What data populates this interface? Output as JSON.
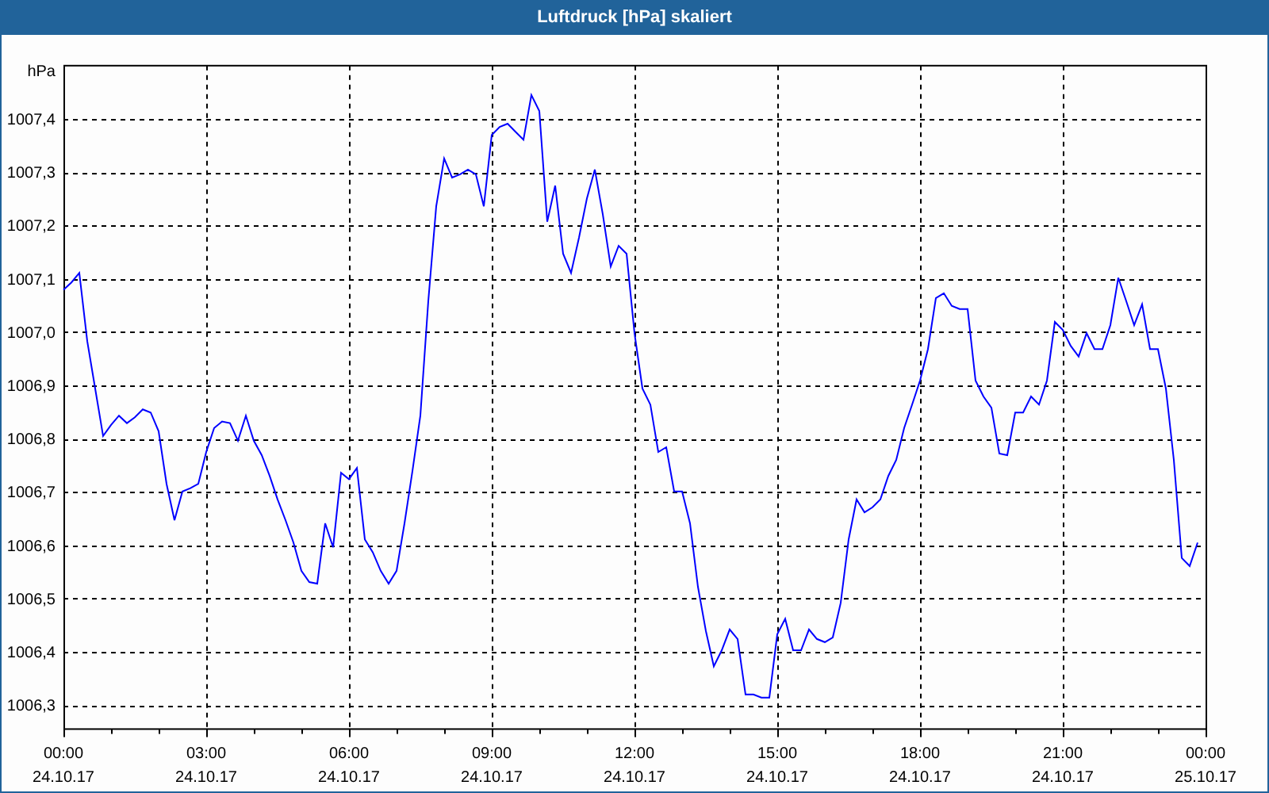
{
  "window": {
    "title": "Luftdruck [hPa] skaliert"
  },
  "chart": {
    "chart_data": {
      "type": "line",
      "ylabel": "hPa",
      "categories": [
        "00:00\n24.10.17",
        null,
        null,
        null,
        null,
        null,
        null,
        null,
        null,
        null,
        null,
        null,
        null,
        null,
        null,
        null,
        null,
        null,
        "03:00\n24.10.17",
        null,
        null,
        null,
        null,
        null,
        null,
        null,
        null,
        null,
        null,
        null,
        null,
        null,
        null,
        null,
        null,
        null,
        "06:00\n24.10.17",
        null,
        null,
        null,
        null,
        null,
        null,
        null,
        null,
        null,
        null,
        null,
        null,
        null,
        null,
        null,
        null,
        null,
        "09:00\n24.10.17",
        null,
        null,
        null,
        null,
        null,
        null,
        null,
        null,
        null,
        null,
        null,
        null,
        null,
        null,
        null,
        null,
        null,
        "12:00\n24.10.17",
        null,
        null,
        null,
        null,
        null,
        null,
        null,
        null,
        null,
        null,
        null,
        null,
        null,
        null,
        null,
        null,
        null,
        "15:00\n24.10.17",
        null,
        null,
        null,
        null,
        null,
        null,
        null,
        null,
        null,
        null,
        null,
        null,
        null,
        null,
        null,
        null,
        null,
        "18:00\n24.10.17",
        null,
        null,
        null,
        null,
        null,
        null,
        null,
        null,
        null,
        null,
        null,
        null,
        null,
        null,
        null,
        null,
        null,
        "21:00\n24.10.17",
        null,
        null,
        null,
        null,
        null,
        null,
        null,
        null,
        null,
        null,
        null,
        null,
        null,
        null,
        null,
        null,
        null,
        "00:00\n25.10.17"
      ],
      "series": [
        {
          "color": "#0000ff",
          "values": [
            1007.079,
            1007.093,
            1007.111,
            1006.983,
            1006.894,
            1006.805,
            1006.826,
            1006.843,
            1006.829,
            1006.84,
            1006.855,
            1006.849,
            1006.814,
            1006.715,
            1006.647,
            1006.701,
            1006.707,
            1006.715,
            1006.775,
            1006.82,
            1006.832,
            1006.829,
            1006.796,
            1006.843,
            1006.796,
            1006.769,
            1006.73,
            1006.686,
            1006.647,
            1006.605,
            1006.552,
            1006.531,
            1006.528,
            1006.641,
            1006.596,
            1006.736,
            1006.724,
            1006.745,
            1006.611,
            1006.587,
            1006.552,
            1006.528,
            1006.552,
            1006.641,
            1006.739,
            1006.843,
            1007.058,
            1007.236,
            1007.326,
            1007.29,
            1007.296,
            1007.305,
            1007.296,
            1007.236,
            1007.37,
            1007.385,
            1007.391,
            1007.376,
            1007.361,
            1007.445,
            1007.415,
            1007.207,
            1007.275,
            1007.147,
            1007.111,
            1007.177,
            1007.251,
            1007.305,
            1007.221,
            1007.123,
            1007.162,
            1007.147,
            1006.998,
            1006.894,
            1006.864,
            1006.775,
            1006.784,
            1006.701,
            1006.701,
            1006.641,
            1006.522,
            1006.439,
            1006.373,
            1006.403,
            1006.442,
            1006.424,
            1006.32,
            1006.32,
            1006.314,
            1006.314,
            1006.433,
            1006.462,
            1006.403,
            1006.403,
            1006.442,
            1006.424,
            1006.418,
            1006.427,
            1006.492,
            1006.611,
            1006.686,
            1006.662,
            1006.671,
            1006.686,
            1006.73,
            1006.76,
            1006.82,
            1006.864,
            1006.909,
            1006.968,
            1007.064,
            1007.073,
            1007.049,
            1007.043,
            1007.043,
            1006.909,
            1006.879,
            1006.858,
            1006.772,
            1006.769,
            1006.849,
            1006.849,
            1006.879,
            1006.864,
            1006.909,
            1007.019,
            1007.004,
            1006.974,
            1006.954,
            1006.998,
            1006.968,
            1006.968,
            1007.013,
            1007.102,
            1007.058,
            1007.013,
            1007.052,
            1006.968,
            1006.968,
            1006.894,
            1006.76,
            1006.576,
            1006.561,
            1006.605,
            null
          ]
        }
      ],
      "ylim": [
        1006.255,
        1007.5
      ],
      "grid": true,
      "yticks": [
        {
          "value": 1006.3,
          "label": "1006,3"
        },
        {
          "value": 1006.4,
          "label": "1006,4"
        },
        {
          "value": 1006.5,
          "label": "1006,5"
        },
        {
          "value": 1006.6,
          "label": "1006,6"
        },
        {
          "value": 1006.7,
          "label": "1006,7"
        },
        {
          "value": 1006.8,
          "label": "1006,8"
        },
        {
          "value": 1006.9,
          "label": "1006,9"
        },
        {
          "value": 1007.0,
          "label": "1007,0"
        },
        {
          "value": 1007.1,
          "label": "1007,1"
        },
        {
          "value": 1007.2,
          "label": "1007,2"
        },
        {
          "value": 1007.3,
          "label": "1007,3"
        },
        {
          "value": 1007.4,
          "label": "1007,4"
        }
      ]
    }
  }
}
